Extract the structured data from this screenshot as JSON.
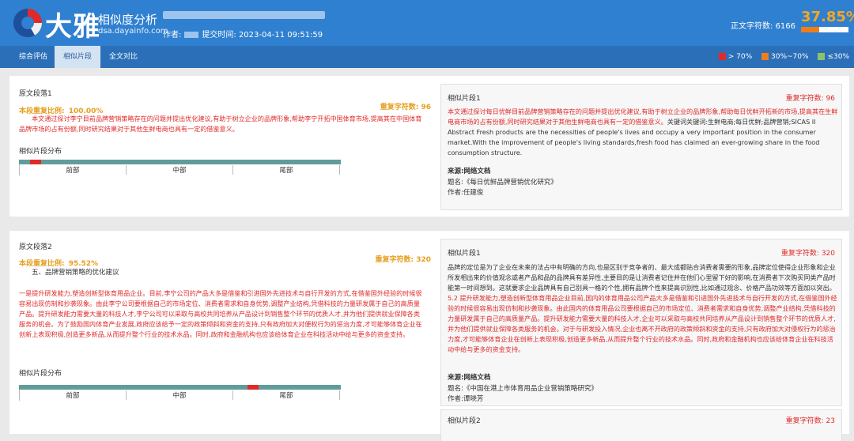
{
  "header": {
    "logo_text": "大雅",
    "brand_title": "相似度分析",
    "brand_url": "dsa.dayainfo.com",
    "meta_author_label": "作者:",
    "meta_submit_label": "提交时间:",
    "meta_submit_time": "2023-04-11 09:51:59",
    "words_label": "正文字符数:",
    "words_value": "6166",
    "similarity_pct": "37.85%",
    "similarity_fraction": 0.3785
  },
  "tabs": [
    {
      "label": "综合评估"
    },
    {
      "label": "相似片段"
    },
    {
      "label": "全文对比"
    }
  ],
  "legend": {
    "items": [
      {
        "label": "> 70%",
        "color": "#e02a2a"
      },
      {
        "label": "30%~70%",
        "color": "#ef7d1a"
      },
      {
        "label": "≤30%",
        "color": "#8cc36a"
      }
    ]
  },
  "segments": [
    {
      "title": "原文段落1",
      "ratio_label": "本段重复比例:",
      "ratio_value": "100.00%",
      "dup_label": "重复字符数:",
      "dup_value": "96",
      "heading": "",
      "text": "本文通过探讨李宁目前品牌营销策略存在的问题并提出优化建议,有助于树立企业的品牌形象,帮助李宁开拓中国体育市场,提高其在中国体育品牌市场的占有份额,同时研究结果对于其他生鲜电商也具有一定的借鉴意义。",
      "dist_title": "相似片段分布",
      "dist_labels": [
        "前部",
        "中部",
        "尾部"
      ],
      "dist_mark": {
        "start": 0.035,
        "end": 0.07
      },
      "match": {
        "title": "相似片段1",
        "dup_label": "重复字符数:",
        "dup_value": "96",
        "text_red": "本文通过探讨每日优鲜目前品牌营销策略存在的问题并提出优化建议,有助于树立企业的品牌形象,帮助每日优鲜开拓新的市场,提高其在生鲜电商市场的占有份额,同时研究结果对于其他生鲜电商也具有一定的借鉴意义。",
        "text_plain": "关键词关键词:生鲜电商;每日优鲜;品牌营销;SICAS II Abstract Fresh products are the necessities of people's lives and occupy a very important position in the consumer market.With the improvement of people's living standards,fresh food has claimed an ever-growing share in the food consumption structure.",
        "source_label": "来源:",
        "source_value": "网络文档",
        "name_label": "题名:",
        "name_value": "《每日优鲜品牌营销优化研究》",
        "author_label": "作者:",
        "author_value": "任建俊"
      }
    },
    {
      "title": "原文段落2",
      "ratio_label": "本段重复比例:",
      "ratio_value": "95.52%",
      "dup_label": "重复字符数:",
      "dup_value": "320",
      "heading": "五、品牌营销策略的优化建议",
      "text": "一是提升研发能力,塑造创新型体育用品企业。目前,李宁公司的产品大多是借鉴和引进国外先进技术与自行开发的方式,在借鉴国外经验的时候很容易出现仿制和抄袭现象。由此李宁公司要根据自己的市场定位、消费者需求和自身优势,调整产业结构,凭借科技的力量研发属于自己的高质量产品。提升研发能力需要大量的科技人才,李宁公司可以采取与高校共同培养从产品设计到销售整个环节的优质人才,并为他们提供就业保障各类服务的机会。为了鼓励国内体育产业发展,政府应该给予一定的政策倾斜和资金的支持,只有政府加大对便权行为的惩治力度,才可能够体育企业在创新上表现积极,创造更多新品,从而提升整个行业的技术水品。同时,政府和金融机构也应该给体育企业在科技活动中给与更多的资金支持。",
      "dist_title": "相似片段分布",
      "dist_labels": [
        "前部",
        "中部",
        "尾部"
      ],
      "dist_mark": {
        "start": 0.71,
        "end": 0.745
      },
      "match": {
        "title": "相似片段1",
        "dup_label": "重复字符数:",
        "dup_value": "320",
        "text_plain": "品牌的定位是为了企业在未来的法占中有明确的方向,也是区别于竞争者的、最大成都贴合消费者需要的形象,品牌定位使得企业形象和企业所发相出来的价值观念或者产品和品的品牌具有差异性,主要目的是让消费者记住并在他们心里留下好的影响,在消费者下次购买同类产品时能第一时间想到。这就要求企业品牌具有自己别具一格的个性,拥有品牌个性来提高识别性,比如通过观念、价格产品功效等方面加以突出。",
        "text_red": "5.2 提升研发能力,塑造创新型体育用品企业目前,国内的体育用品公司产品大多是借鉴和引进国外先进技术与自行开发的方式,在借鉴国外经验的时候很容易出现仿制和抄袭现象。由此国内的体育用品公司要根据自己的市场定位、消费者需求和自身优势,调整产业结构,凭借科技的力量研发属于自己的高质量产品。提升研发能力需要大量的科技人才,企业可以采取与高校共同培养从产品设计到销售整个环节的优质人才,并为他们提供就业保障各类服务的机会。对于与研发投入情况,企业也离不开政府的政策倾斜和资金的支持,只有政府加大对侵权行为的惩治力度,才可能够体育企业在创新上表现积极,创造更多新品,从而提升整个行业的技术水品。同时,政府和金融机构也应该给体育企业在科技活动中给与更多的资金支持。",
        "source_label": "来源:",
        "source_value": "网络文档",
        "name_label": "题名:",
        "name_value": "《中国在港上市体育用品企业营销策略研究》",
        "author_label": "作者:",
        "author_value": "谭晓芳"
      },
      "match2": {
        "title": "相似片段2",
        "dup_label": "重复字符数:",
        "dup_value": "23"
      }
    }
  ]
}
